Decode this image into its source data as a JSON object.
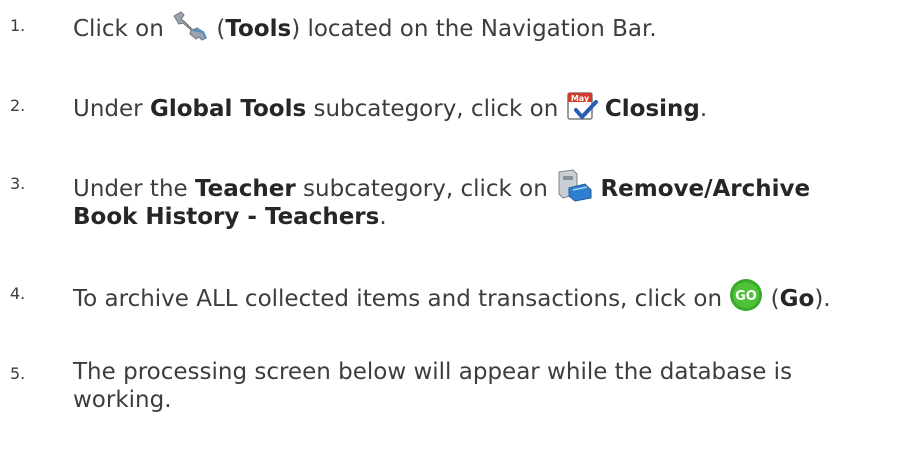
{
  "steps": [
    {
      "number": "1.",
      "before": "Click on ",
      "icon": "wrench-icon",
      "mid1": " (",
      "bold1": "Tools",
      "after": ") located on the Navigation Bar."
    },
    {
      "number": "2.",
      "before": "Under ",
      "bold1": "Global Tools",
      "mid1": " subcategory, click on ",
      "icon": "calendar-check-icon",
      "icon_text": "May",
      "bold2": "Closing",
      "after": "."
    },
    {
      "number": "3.",
      "before": "Under the ",
      "bold1": "Teacher",
      "mid1": " subcategory, click on ",
      "icon": "archive-box-icon",
      "bold2": "Remove/Archive",
      "bold3": "Book History - Teachers",
      "after": "."
    },
    {
      "number": "4.",
      "before": "To archive ALL collected items and transactions, click on ",
      "icon": "go-icon",
      "icon_text": "GO",
      "mid1": " (",
      "bold1": "Go",
      "after": ")."
    },
    {
      "number": "5.",
      "line1": "The processing screen below will appear while the database is",
      "line2": "working."
    }
  ],
  "colors": {
    "text": "#3d3d3d",
    "bold": "#262626",
    "go_green": "#3aaa2a",
    "calendar_red": "#d23a2a",
    "check_blue": "#2a5db0"
  }
}
